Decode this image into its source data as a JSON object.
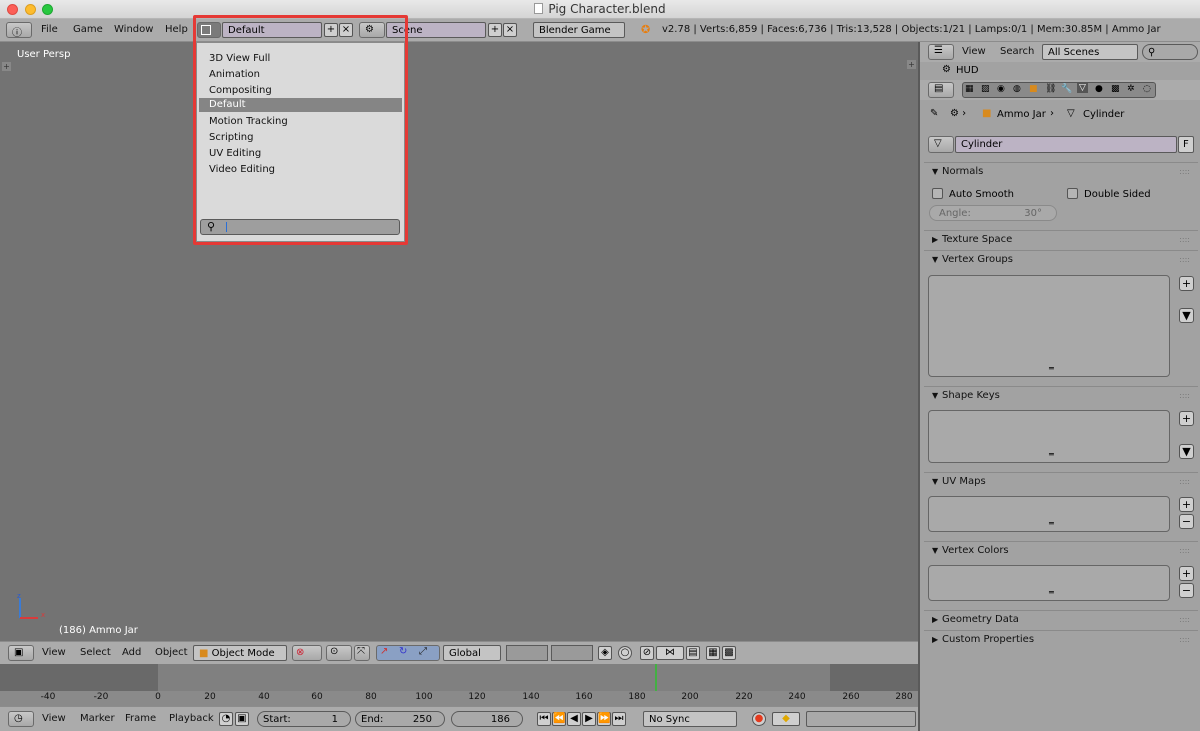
{
  "window": {
    "title": "Pig Character.blend"
  },
  "infobar": {
    "menus": [
      "File",
      "Game",
      "Window",
      "Help"
    ],
    "layout_name": "Default",
    "scene_name": "Scene",
    "engine": "Blender Game",
    "stats": "v2.78 | Verts:6,859 | Faces:6,736 | Tris:13,528 | Objects:1/21 | Lamps:0/1 | Mem:30.85M | Ammo Jar"
  },
  "viewport": {
    "view_label": "User Persp",
    "object_label": "(186) Ammo Jar"
  },
  "layout_dropdown": {
    "items": [
      "3D View Full",
      "Animation",
      "Compositing",
      "Default",
      "Motion Tracking",
      "Scripting",
      "UV Editing",
      "Video Editing"
    ],
    "active": "Default"
  },
  "view3d_header": {
    "menus": [
      "View",
      "Select",
      "Add",
      "Object"
    ],
    "mode": "Object Mode",
    "orientation": "Global"
  },
  "timeline": {
    "ticks": [
      "-40",
      "-20",
      "0",
      "20",
      "40",
      "60",
      "80",
      "100",
      "120",
      "140",
      "160",
      "180",
      "200",
      "220",
      "240",
      "260",
      "280"
    ],
    "current_frame": 186
  },
  "timeline_header": {
    "menus": [
      "View",
      "Marker",
      "Frame",
      "Playback"
    ],
    "start_label": "Start:",
    "start_value": "1",
    "end_label": "End:",
    "end_value": "250",
    "frame_value": "186",
    "sync": "No Sync"
  },
  "properties": {
    "header_menus": [
      "View",
      "Search"
    ],
    "scenes_filter": "All Scenes",
    "outliner_item": "HUD",
    "breadcrumb": [
      "Ammo Jar",
      "Cylinder"
    ],
    "mesh_name": "Cylinder",
    "fake_user_label": "F",
    "panels": {
      "normals": "Normals",
      "auto_smooth": "Auto Smooth",
      "double_sided": "Double Sided",
      "angle_label": "Angle:",
      "angle_value": "30°",
      "texture_space": "Texture Space",
      "vertex_groups": "Vertex Groups",
      "shape_keys": "Shape Keys",
      "uv_maps": "UV Maps",
      "vertex_colors": "Vertex Colors",
      "geometry_data": "Geometry Data",
      "custom_properties": "Custom Properties"
    }
  },
  "colors": {
    "highlight_outline": "#e53935",
    "playhead": "#43b043",
    "timeline_bg": "#6f6f6f"
  }
}
